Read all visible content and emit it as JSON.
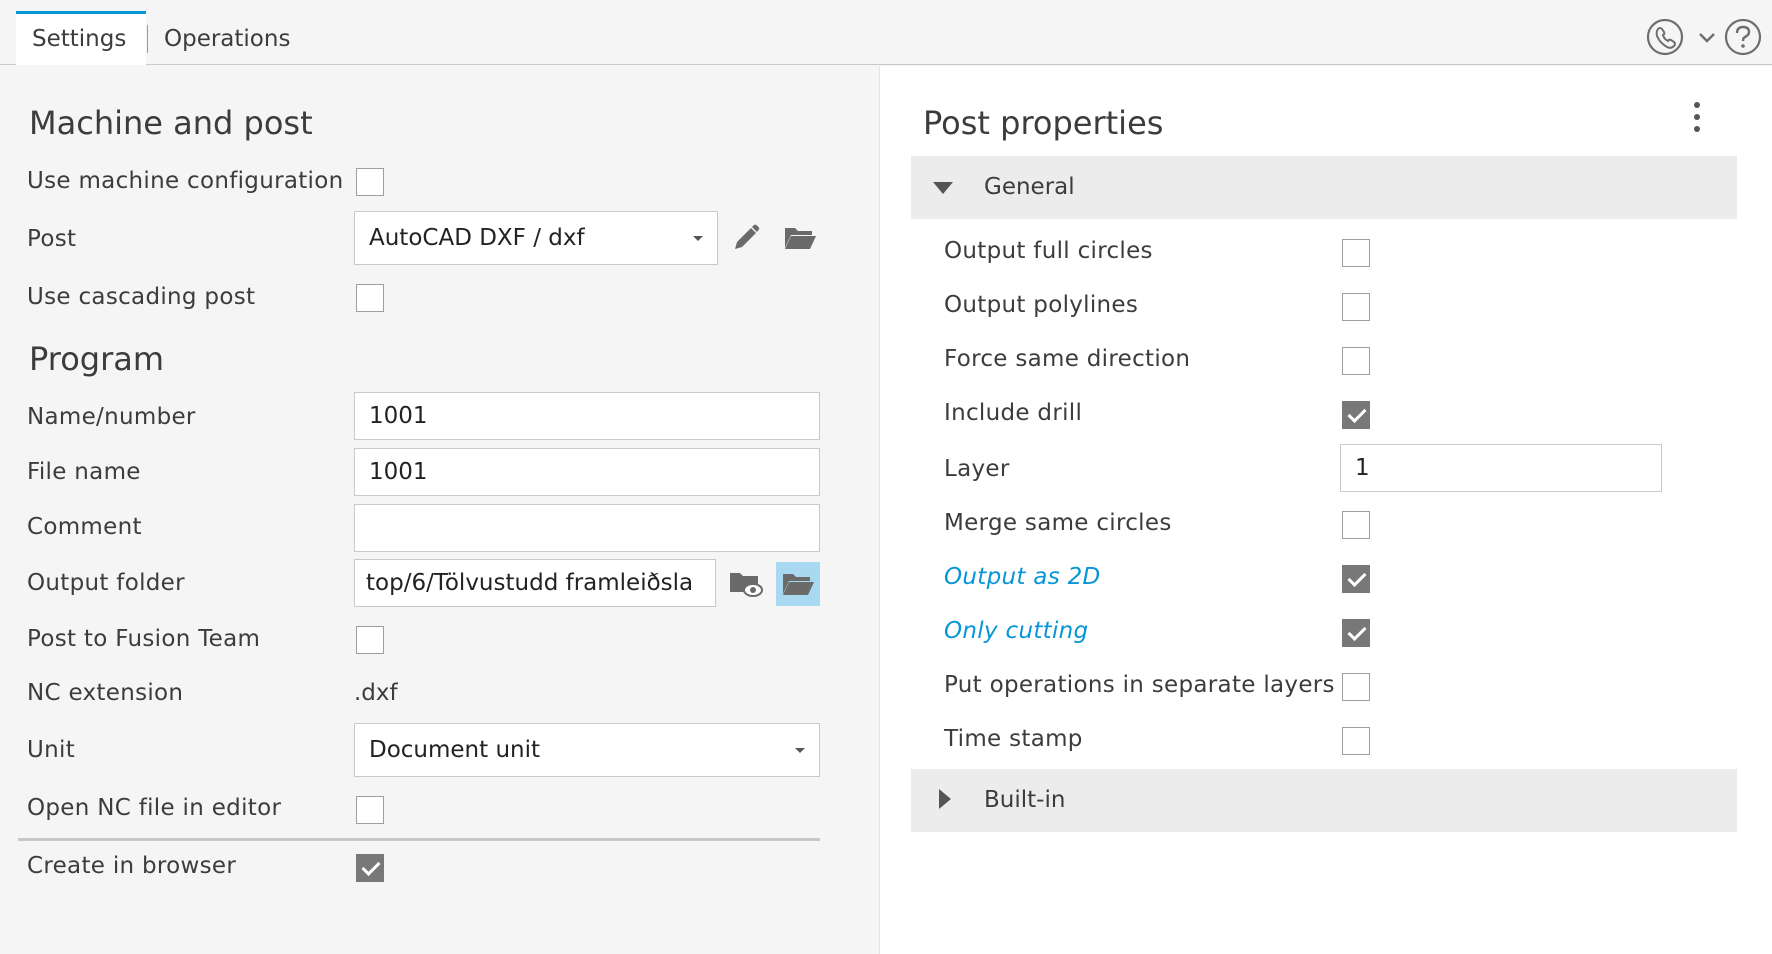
{
  "tabs": [
    {
      "label": "Settings",
      "active": true
    },
    {
      "label": "Operations",
      "active": false
    }
  ],
  "header_icons": [
    "phone-icon",
    "chevron-down-icon",
    "help-icon"
  ],
  "colors": {
    "accent": "#0696d7",
    "highlight": "#a9d8f1",
    "checked": "#787878"
  },
  "machine_and_post": {
    "title": "Machine and post",
    "use_machine_configuration": {
      "label": "Use machine configuration",
      "checked": false
    },
    "post": {
      "label": "Post",
      "value": "AutoCAD DXF / dxf"
    },
    "use_cascading_post": {
      "label": "Use cascading post",
      "checked": false
    }
  },
  "program": {
    "title": "Program",
    "name_number": {
      "label": "Name/number",
      "value": "1001"
    },
    "file_name": {
      "label": "File name",
      "value": "1001"
    },
    "comment": {
      "label": "Comment",
      "value": ""
    },
    "output_folder": {
      "label": "Output folder",
      "value": "top/6/Tölvustudd framleiðsla"
    },
    "post_to_fusion_team": {
      "label": "Post to Fusion Team",
      "checked": false
    },
    "nc_extension": {
      "label": "NC extension",
      "value": ".dxf"
    },
    "unit": {
      "label": "Unit",
      "value": "Document unit"
    },
    "open_nc_file": {
      "label": "Open NC file in editor",
      "checked": false
    },
    "create_in_browser": {
      "label": "Create in browser",
      "checked": true
    }
  },
  "post_properties": {
    "title": "Post properties",
    "general": {
      "label": "General",
      "expanded": true,
      "items": [
        {
          "label": "Output full circles",
          "type": "checkbox",
          "checked": false,
          "modified": false
        },
        {
          "label": "Output polylines",
          "type": "checkbox",
          "checked": false,
          "modified": false
        },
        {
          "label": "Force same direction",
          "type": "checkbox",
          "checked": false,
          "modified": false
        },
        {
          "label": "Include drill",
          "type": "checkbox",
          "checked": true,
          "modified": false
        },
        {
          "label": "Layer",
          "type": "text",
          "value": "1",
          "modified": false
        },
        {
          "label": "Merge same circles",
          "type": "checkbox",
          "checked": false,
          "modified": false
        },
        {
          "label": "Output as 2D",
          "type": "checkbox",
          "checked": true,
          "modified": true
        },
        {
          "label": "Only cutting",
          "type": "checkbox",
          "checked": true,
          "modified": true
        },
        {
          "label": "Put operations in separate layers",
          "type": "checkbox",
          "checked": false,
          "modified": false
        },
        {
          "label": "Time stamp",
          "type": "checkbox",
          "checked": false,
          "modified": false
        }
      ]
    },
    "builtin": {
      "label": "Built-in",
      "expanded": false
    }
  }
}
